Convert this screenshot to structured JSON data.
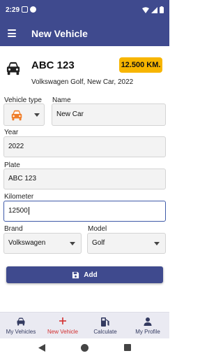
{
  "status_bar": {
    "time": "2:29"
  },
  "app_bar": {
    "title": "New Vehicle"
  },
  "vehicle_summary": {
    "plate": "ABC 123",
    "km_badge": "12.500 KM.",
    "subtitle": "Volkswagen Golf, New Car, 2022"
  },
  "form": {
    "vehicle_type_label": "Vehicle type",
    "name_label": "Name",
    "name_value": "New Car",
    "year_label": "Year",
    "year_value": "2022",
    "plate_label": "Plate",
    "plate_value": "ABC 123",
    "kilometer_label": "Kilometer",
    "kilometer_value": "12500",
    "brand_label": "Brand",
    "brand_value": "Volkswagen",
    "model_label": "Model",
    "model_value": "Golf"
  },
  "add_button": {
    "label": "Add",
    "icon": "save-icon"
  },
  "bottom_nav": {
    "items": [
      {
        "label": "My Vehicles",
        "icon": "car-icon"
      },
      {
        "label": "New Vehicle",
        "icon": "plus-icon",
        "active": true
      },
      {
        "label": "Calculate",
        "icon": "fuel-pump-icon"
      },
      {
        "label": "My Profile",
        "icon": "person-icon"
      }
    ]
  },
  "colors": {
    "primary": "#3f4a8e",
    "badge": "#f7b500",
    "vehicle_type_icon": "#f07e2a",
    "active_nav": "#d32f2f"
  }
}
